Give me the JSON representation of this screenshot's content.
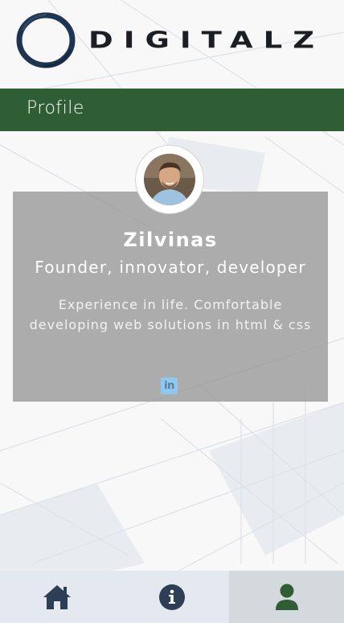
{
  "app": {
    "brand": "DIGITALZ"
  },
  "header": {
    "title": "Profile"
  },
  "profile": {
    "name": "Zilvinas",
    "role": "Founder, innovator, developer",
    "bio": "Experience in life. Comfortable developing web solutions in html & css",
    "social_icon": "linkedin-icon",
    "social_label": "in"
  },
  "nav": {
    "items": [
      {
        "icon": "home-icon",
        "active": false
      },
      {
        "icon": "info-icon",
        "active": false
      },
      {
        "icon": "user-icon",
        "active": true
      }
    ]
  },
  "colors": {
    "title_bar": "#2f5d34",
    "card": "#969696",
    "nav_bg": "#e4e9f0",
    "nav_active": "#d4d9dd",
    "nav_icon_dark": "#2d3e55",
    "nav_icon_active": "#2f5d34",
    "linkedin": "#8fc7ef"
  }
}
